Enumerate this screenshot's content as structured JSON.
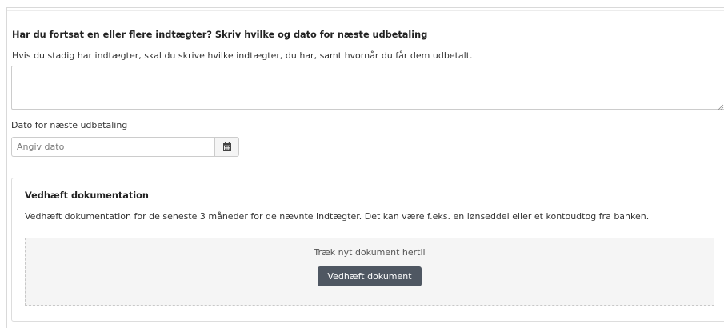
{
  "income_section": {
    "heading": "Har du fortsat en eller flere indtægter? Skriv hvilke og dato for næste udbetaling",
    "help_text": "Hvis du stadig har indtægter, skal du skrive hvilke indtægter, du har, samt hvornår du får dem udbetalt.",
    "textarea_value": ""
  },
  "date_field": {
    "label": "Dato for næste udbetaling",
    "placeholder": "Angiv dato",
    "value": "",
    "icon": "calendar-icon"
  },
  "documentation": {
    "title": "Vedhæft dokumentation",
    "text": "Vedhæft dokumentation for de seneste 3 måneder for de nævnte indtægter. Det kan være f.eks. en lønseddel eller et kontoudtog fra banken.",
    "dropzone_text": "Træk nyt dokument hertil",
    "button_label": "Vedhæft dokument"
  },
  "colors": {
    "button_bg": "#4f5762",
    "dropzone_bg": "#f5f5f5",
    "border": "#cccccc"
  }
}
